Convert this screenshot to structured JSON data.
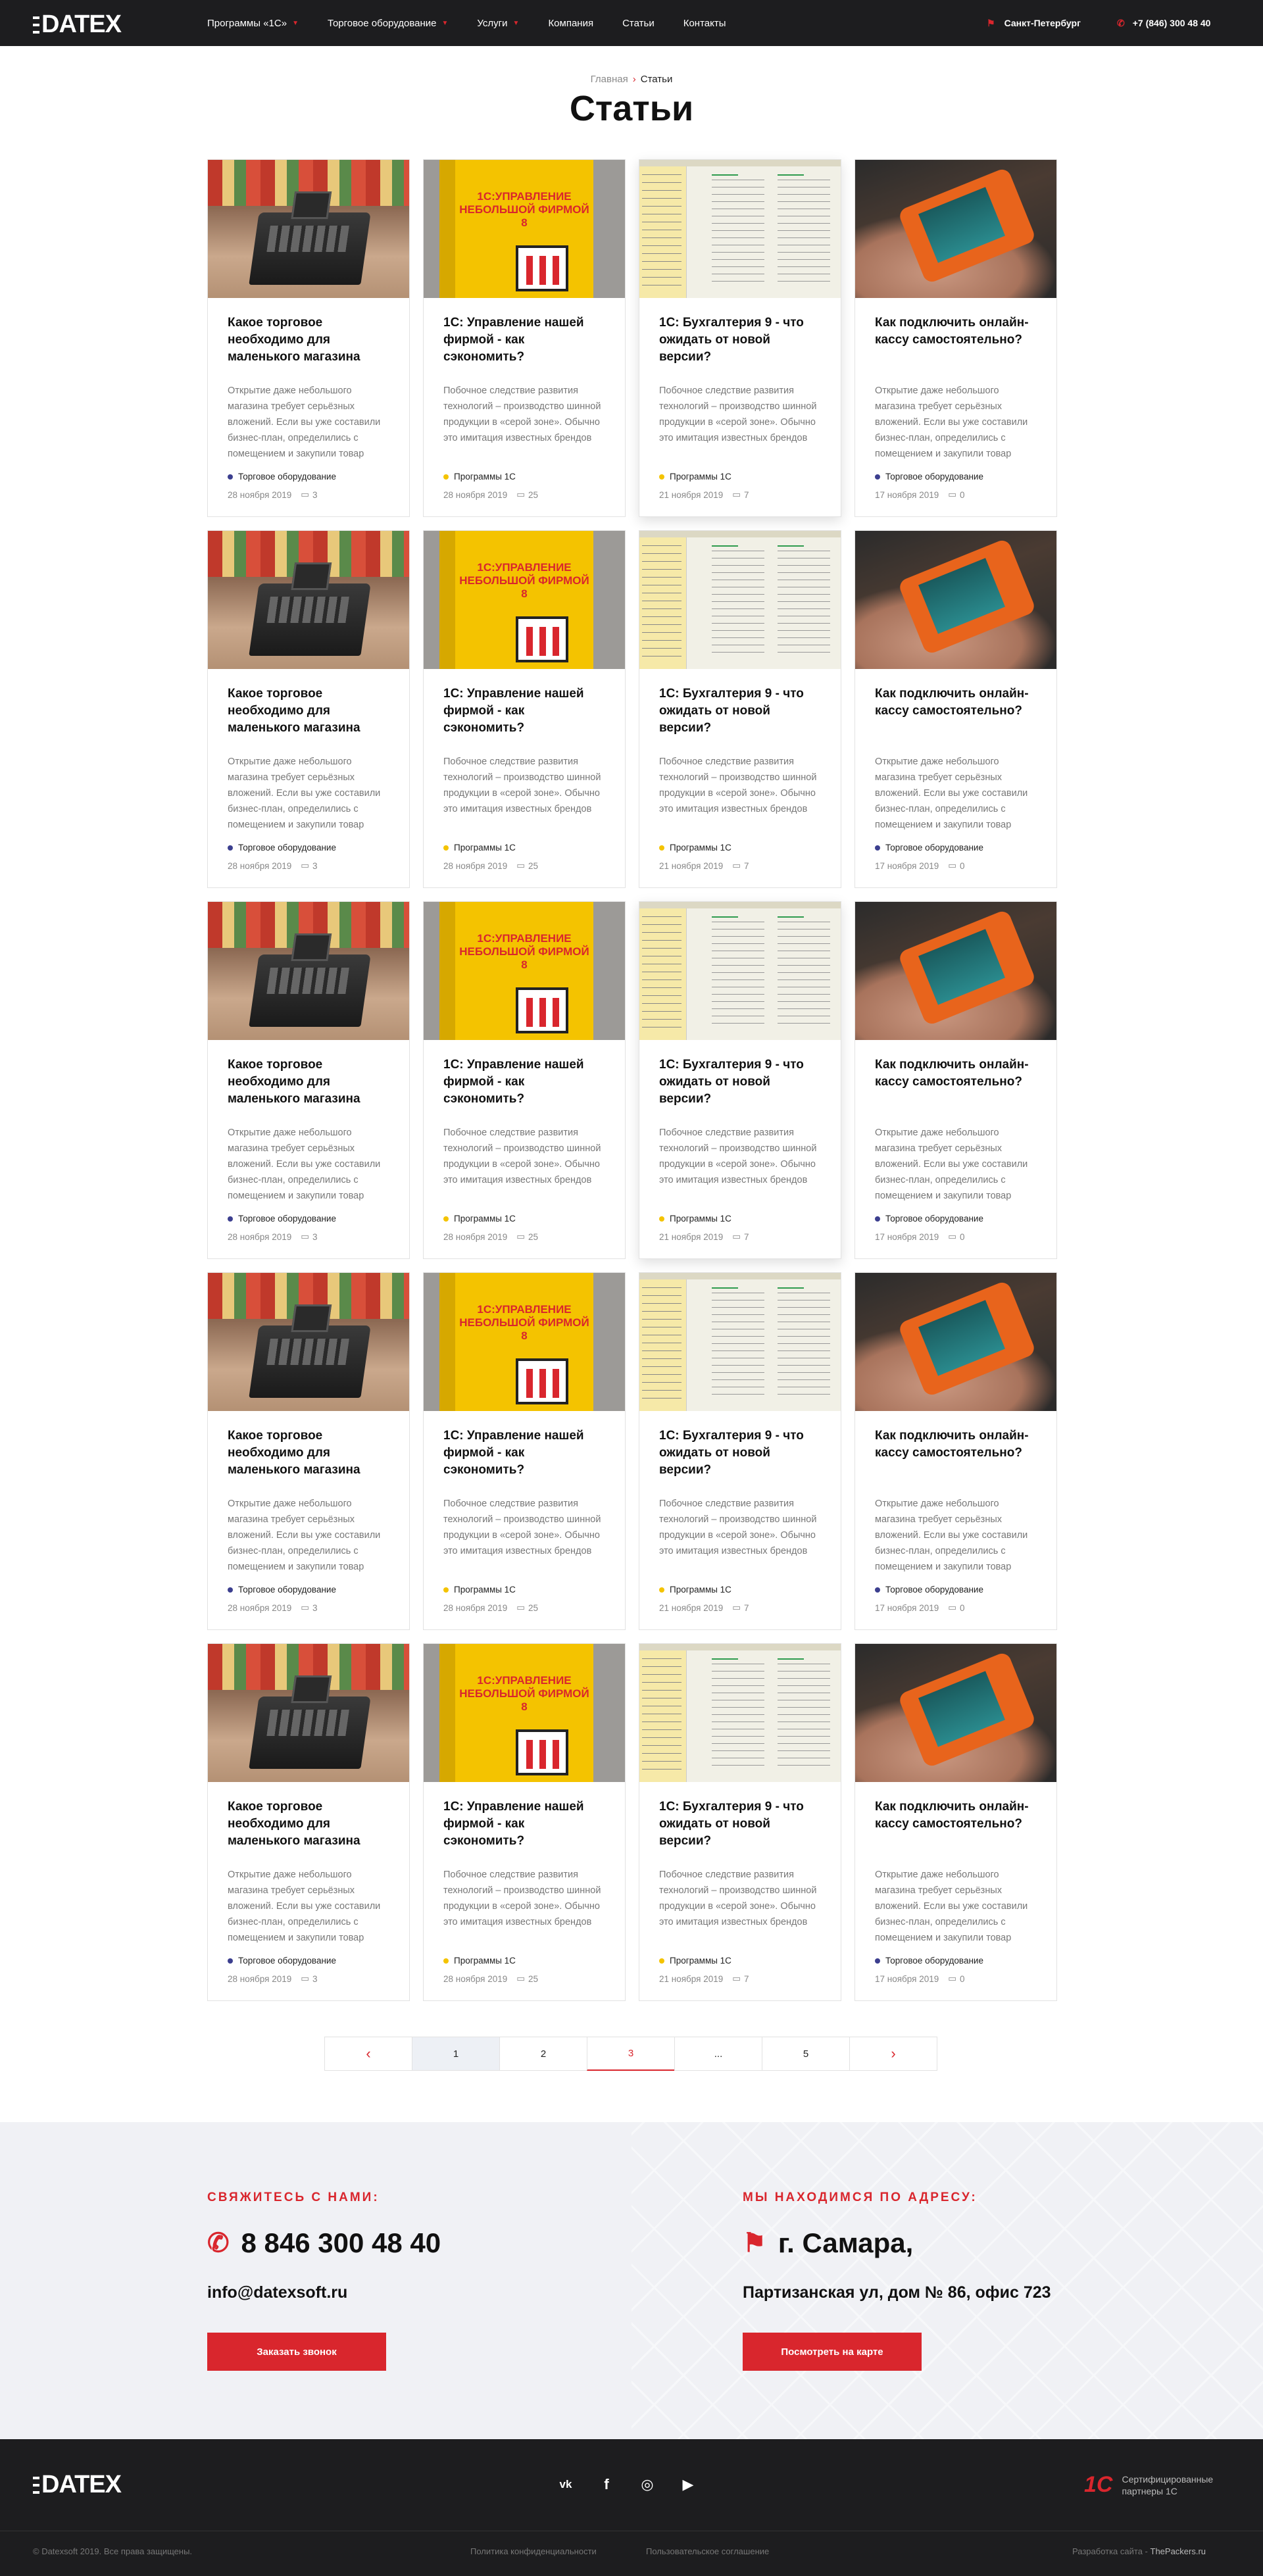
{
  "header": {
    "logo": "DATEX",
    "nav": [
      "Программы «1С»",
      "Торговое оборудование",
      "Услуги",
      "Компания",
      "Статьи",
      "Контакты"
    ],
    "nav_has_dropdown": [
      true,
      true,
      true,
      false,
      false,
      false
    ],
    "city": "Санкт-Петербург",
    "phone": "+7 (846) 300 48 40"
  },
  "breadcrumb": {
    "home": "Главная",
    "separator": "›",
    "current": "Статьи"
  },
  "page_title": "Статьи",
  "articles": [
    {
      "title": "Какое торговое необходимо для маленького магазина",
      "desc": "Открытие даже небольшого магазина требует серьёзных вложений. Если вы уже составили бизнес-план, определились с помещением и закупили товар",
      "category": "Торговое оборудование",
      "date": "28 ноября 2019",
      "comments": "3",
      "thumb": "cash-register",
      "dot": "#3c3f8f"
    },
    {
      "title": "1С: Управление нашей фирмой - как сэкономить?",
      "desc": "Побочное следствие развития технологий – производство шинной продукции в «серой зоне». Обычно это имитация известных брендов",
      "category": "Программы 1С",
      "date": "28 ноября 2019",
      "comments": "25",
      "thumb": "1c-box",
      "dot": "#f4c300"
    },
    {
      "title": "1С: Бухгалтерия 9 - что ожидать от новой версии?",
      "desc": "Побочное следствие развития технологий – производство шинной продукции в «серой зоне». Обычно это имитация известных брендов",
      "category": "Программы 1С",
      "date": "21 ноября 2019",
      "comments": "7",
      "thumb": "1c-screen",
      "dot": "#f4c300"
    },
    {
      "title": "Как подключить онлайн-кассу самостоятельно?",
      "desc": "Открытие даже небольшого магазина требует серьёзных вложений. Если вы уже составили бизнес-план, определились с помещением и закупили товар",
      "category": "Торговое оборудование",
      "date": "17 ноября 2019",
      "comments": "0",
      "thumb": "terminal",
      "dot": "#3c3f8f"
    }
  ],
  "box_text": "1С:УПРАВЛЕНИЕ НЕБОЛЬШОЙ ФИРМОЙ 8",
  "pagination": {
    "prev": "‹",
    "pages": [
      "1",
      "2",
      "3",
      "...",
      "5"
    ],
    "next": "›",
    "current_page": "3"
  },
  "contact": {
    "left_heading": "СВЯЖИТЕСЬ С НАМИ:",
    "phone": "8 846 300 48 40",
    "email": "info@datexsoft.ru",
    "call_button": "Заказать звонок",
    "right_heading": "МЫ НАХОДИМСЯ ПО АДРЕСУ:",
    "city": "г. Самара,",
    "address": "Партизанская ул, дом № 86, офис 723",
    "map_button": "Посмотреть на карте"
  },
  "footer": {
    "logo": "DATEX",
    "social": [
      "vk-icon",
      "facebook-icon",
      "instagram-icon",
      "youtube-icon"
    ],
    "cert_logo": "1С",
    "cert_text": "Сертифицированные партнеры 1С",
    "copyright": "© Datexsoft 2019. Все права защищены.",
    "privacy": "Политика конфиденциальности",
    "agreement": "Пользовательское соглашение",
    "dev_label": "Разработка сайта -",
    "dev_name": "ThePackers.ru"
  },
  "colors": {
    "accent": "#d9262d",
    "dark": "#1d1d1f",
    "category_equipment": "#3c3f8f",
    "category_1c": "#f4c300"
  }
}
